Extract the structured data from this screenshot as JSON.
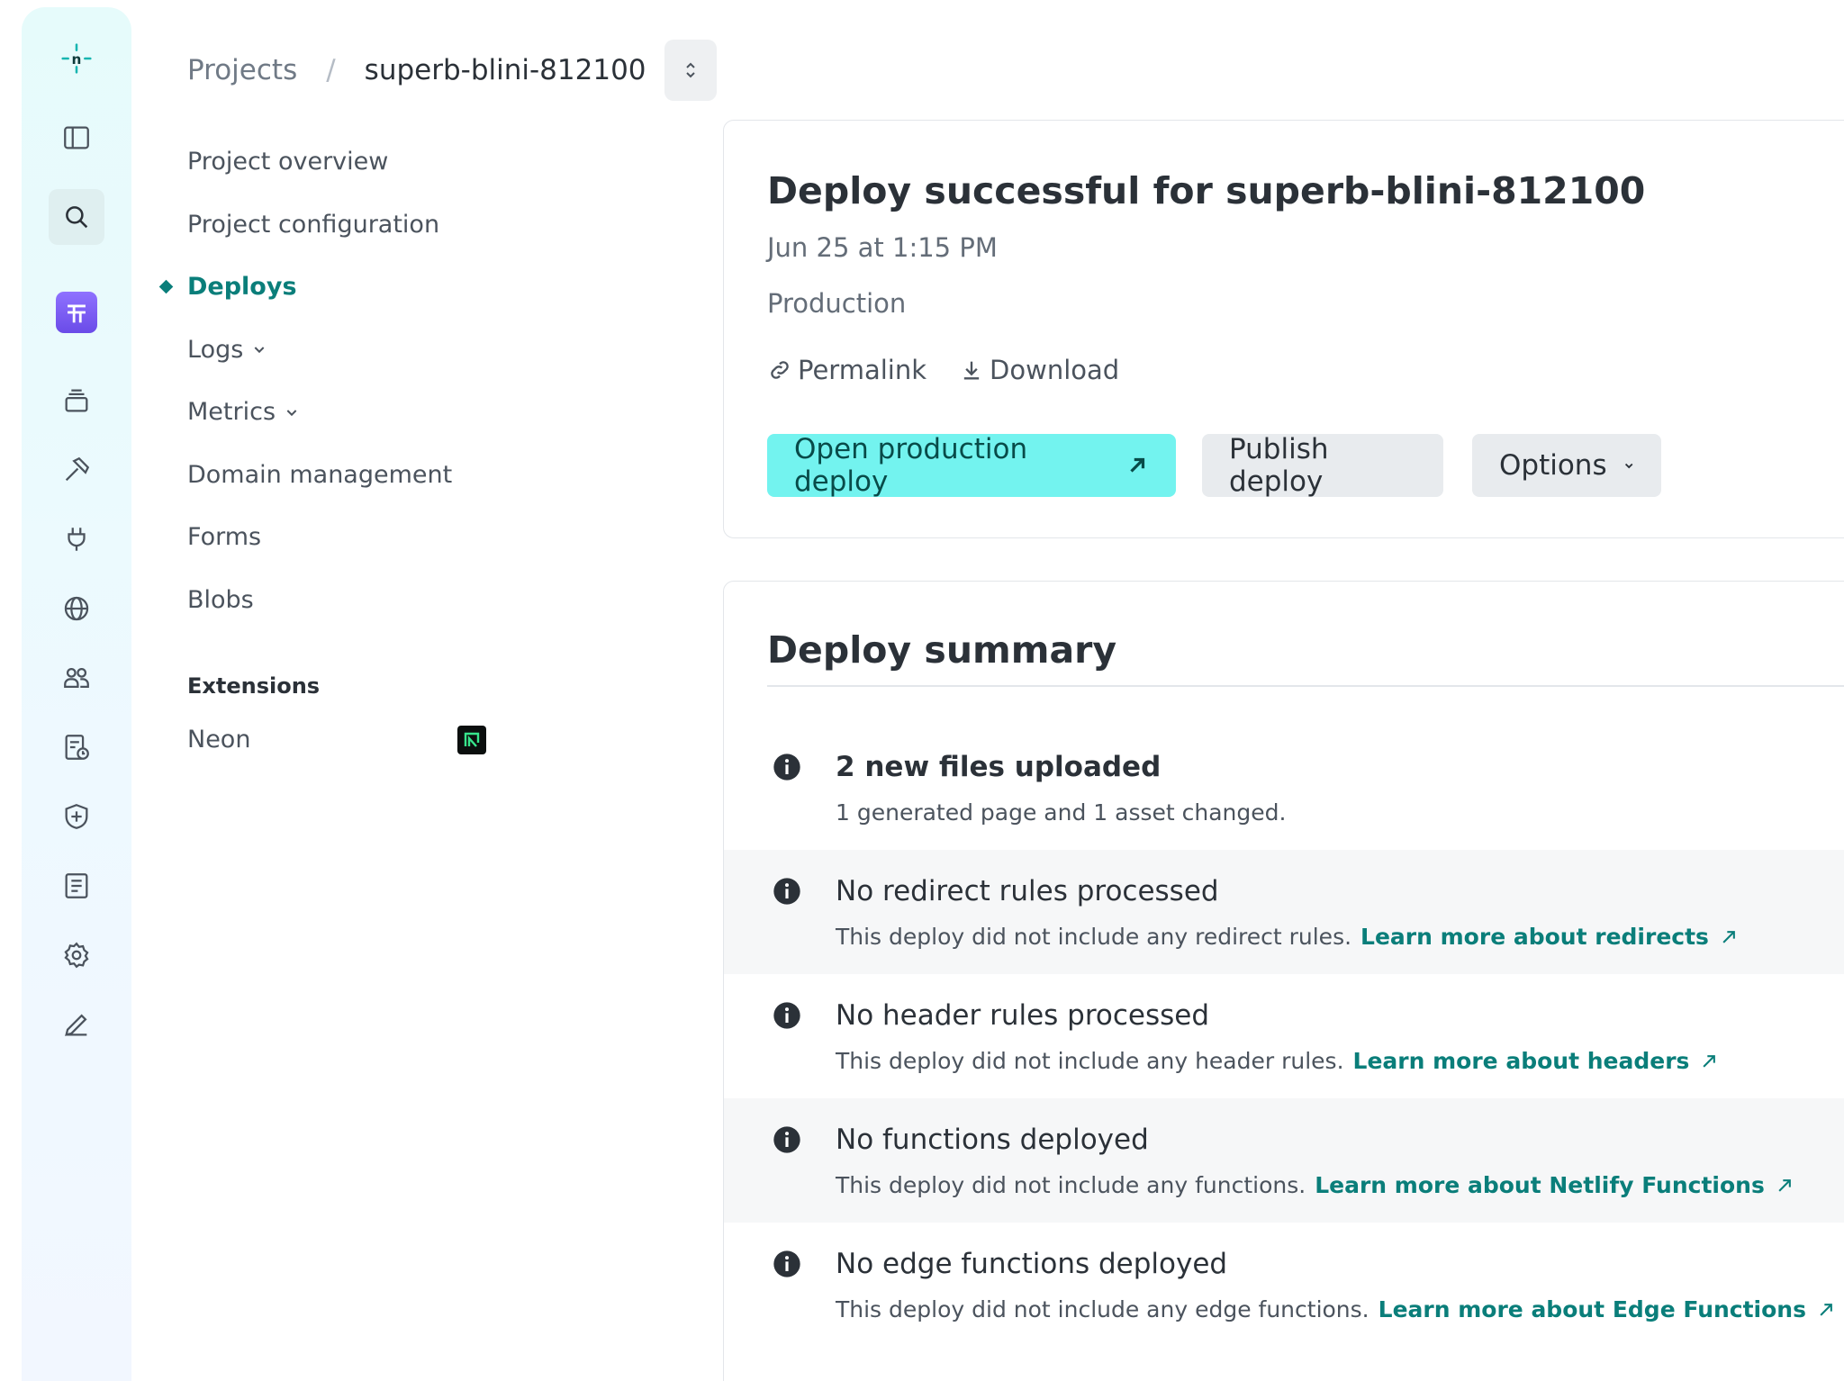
{
  "breadcrumb": {
    "root": "Projects",
    "separator": "/",
    "current": "superb-blini-812100"
  },
  "rail": {
    "icons": [
      "netlify-logo-icon",
      "sidebar-toggle-icon",
      "search-icon",
      "extension-app-icon",
      "layers-icon",
      "build-hammer-icon",
      "plug-icon",
      "globe-icon",
      "team-icon",
      "usage-icon",
      "shield-icon",
      "docs-icon",
      "settings-gear-icon",
      "edit-pen-icon"
    ]
  },
  "nav": {
    "items": [
      {
        "label": "Project overview"
      },
      {
        "label": "Project configuration"
      },
      {
        "label": "Deploys",
        "active": true
      },
      {
        "label": "Logs",
        "expandable": true
      },
      {
        "label": "Metrics",
        "expandable": true
      },
      {
        "label": "Domain management"
      },
      {
        "label": "Forms"
      },
      {
        "label": "Blobs"
      }
    ],
    "extensions_heading": "Extensions",
    "extensions": [
      {
        "label": "Neon"
      }
    ]
  },
  "deploy": {
    "title": "Deploy successful for superb-blini-812100",
    "date": "Jun 25 at 1:15 PM",
    "context": "Production",
    "permalink": "Permalink",
    "download": "Download",
    "open_button": "Open production deploy",
    "publish_button": "Publish deploy",
    "options_button": "Options"
  },
  "summary": {
    "title": "Deploy summary",
    "rows": [
      {
        "title": "2 new files uploaded",
        "desc": "1 generated page and 1 asset changed.",
        "link": ""
      },
      {
        "title": "No redirect rules processed",
        "desc": "This deploy did not include any redirect rules.",
        "link": "Learn more about redirects"
      },
      {
        "title": "No header rules processed",
        "desc": "This deploy did not include any header rules.",
        "link": "Learn more about headers"
      },
      {
        "title": "No functions deployed",
        "desc": "This deploy did not include any functions.",
        "link": "Learn more about Netlify Functions"
      },
      {
        "title": "No edge functions deployed",
        "desc": "This deploy did not include any edge functions.",
        "link": "Learn more about Edge Functions"
      }
    ]
  },
  "colors": {
    "accent": "#0a7e7a",
    "primary_button": "#73f3ef",
    "rail_bg": "#e6fbfb"
  }
}
